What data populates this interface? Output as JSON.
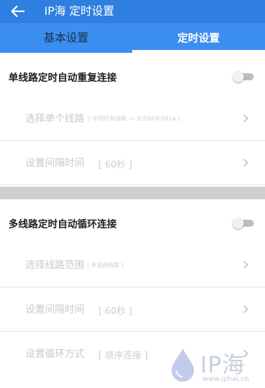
{
  "header": {
    "title": "IP海 定时设置"
  },
  "tabs": [
    {
      "label": "基本设置",
      "selected": false
    },
    {
      "label": "定时设置",
      "selected": true
    }
  ],
  "section_single": {
    "title": "单线路定时自动重复连接",
    "toggle_on": false,
    "rows": [
      {
        "label": "选择单个线路",
        "sub": "[ 中国所有线路 -> 北京BGP-001A ]"
      },
      {
        "label": "设置间隔时间",
        "value": "[ 60秒 ]"
      }
    ]
  },
  "section_multi": {
    "title": "多线路定时自动循环连接",
    "toggle_on": false,
    "rows": [
      {
        "label": "选择线路范围",
        "sub": "[ 未选择线路 ]"
      },
      {
        "label": "设置间隔时间",
        "value": "[ 60秒 ]"
      },
      {
        "label": "设置循环方式",
        "value": "[ 顺序连接 ]"
      }
    ]
  },
  "watermark": {
    "brand": "IP海",
    "url": "www.iphai.cn"
  },
  "colors": {
    "appbar": "#2f7fe0",
    "tabbar": "#3c8ef0",
    "disabled_text": "#c9c9c9"
  }
}
